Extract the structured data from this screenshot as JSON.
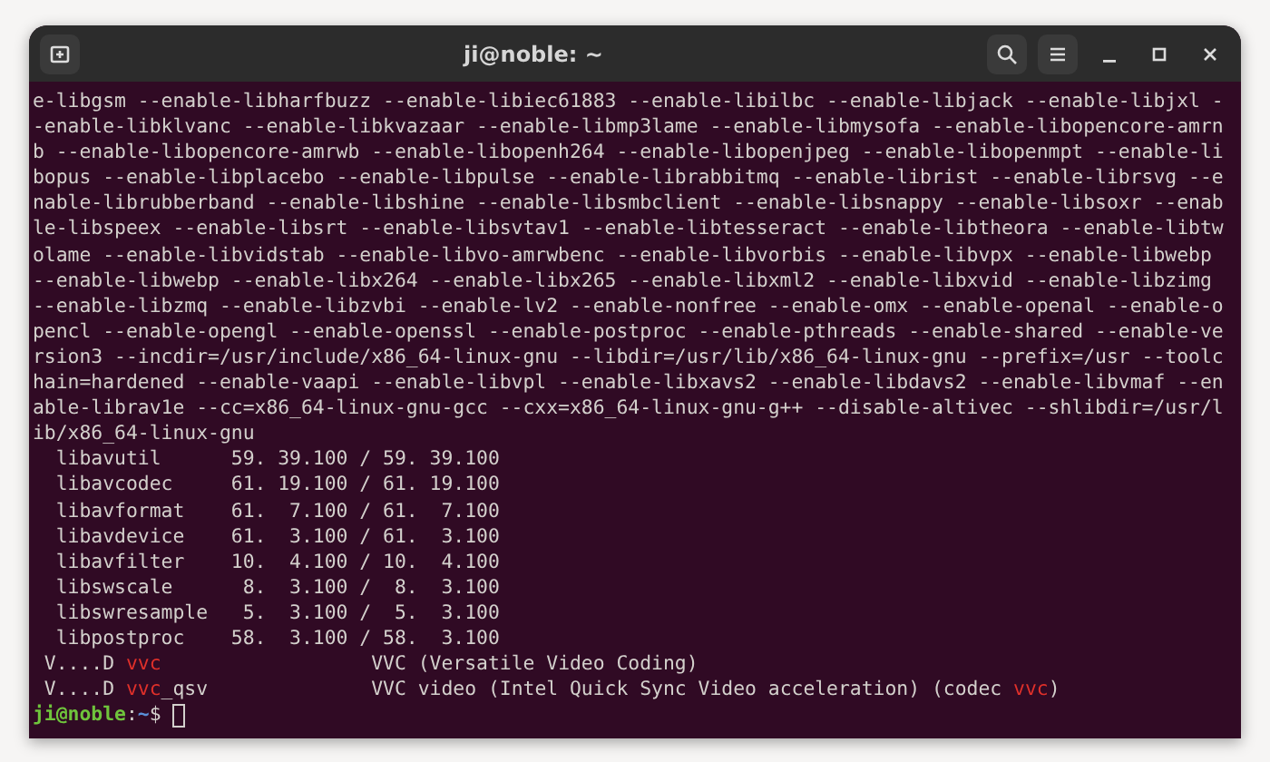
{
  "window": {
    "title": "ji@noble: ~"
  },
  "terminal": {
    "lines": [
      [
        {
          "text": "e-libgsm --enable-libharfbuzz --enable-libiec61883 --enable-libilbc --enable-libjack --enable-libjxl -",
          "kind": "plain"
        }
      ],
      [
        {
          "text": "-enable-libklvanc --enable-libkvazaar --enable-libmp3lame --enable-libmysofa --enable-libopencore-amrn",
          "kind": "plain"
        }
      ],
      [
        {
          "text": "b --enable-libopencore-amrwb --enable-libopenh264 --enable-libopenjpeg --enable-libopenmpt --enable-li",
          "kind": "plain"
        }
      ],
      [
        {
          "text": "bopus --enable-libplacebo --enable-libpulse --enable-librabbitmq --enable-librist --enable-librsvg --e",
          "kind": "plain"
        }
      ],
      [
        {
          "text": "nable-librubberband --enable-libshine --enable-libsmbclient --enable-libsnappy --enable-libsoxr --enab",
          "kind": "plain"
        }
      ],
      [
        {
          "text": "le-libspeex --enable-libsrt --enable-libsvtav1 --enable-libtesseract --enable-libtheora --enable-libtw",
          "kind": "plain"
        }
      ],
      [
        {
          "text": "olame --enable-libvidstab --enable-libvo-amrwbenc --enable-libvorbis --enable-libvpx --enable-libwebp",
          "kind": "plain"
        }
      ],
      [
        {
          "text": "--enable-libwebp --enable-libx264 --enable-libx265 --enable-libxml2 --enable-libxvid --enable-libzimg",
          "kind": "plain"
        }
      ],
      [
        {
          "text": "--enable-libzmq --enable-libzvbi --enable-lv2 --enable-nonfree --enable-omx --enable-openal --enable-o",
          "kind": "plain"
        }
      ],
      [
        {
          "text": "pencl --enable-opengl --enable-openssl --enable-postproc --enable-pthreads --enable-shared --enable-ve",
          "kind": "plain"
        }
      ],
      [
        {
          "text": "rsion3 --incdir=/usr/include/x86_64-linux-gnu --libdir=/usr/lib/x86_64-linux-gnu --prefix=/usr --toolc",
          "kind": "plain"
        }
      ],
      [
        {
          "text": "hain=hardened --enable-vaapi --enable-libvpl --enable-libxavs2 --enable-libdavs2 --enable-libvmaf --en",
          "kind": "plain"
        }
      ],
      [
        {
          "text": "able-librav1e --cc=x86_64-linux-gnu-gcc --cxx=x86_64-linux-gnu-g++ --disable-altivec --shlibdir=/usr/l",
          "kind": "plain"
        }
      ],
      [
        {
          "text": "ib/x86_64-linux-gnu",
          "kind": "plain"
        }
      ],
      [
        {
          "text": "  libavutil      59. 39.100 / 59. 39.100",
          "kind": "plain"
        }
      ],
      [
        {
          "text": "  libavcodec     61. 19.100 / 61. 19.100",
          "kind": "plain"
        }
      ],
      [
        {
          "text": "  libavformat    61.  7.100 / 61.  7.100",
          "kind": "plain"
        }
      ],
      [
        {
          "text": "  libavdevice    61.  3.100 / 61.  3.100",
          "kind": "plain"
        }
      ],
      [
        {
          "text": "  libavfilter    10.  4.100 / 10.  4.100",
          "kind": "plain"
        }
      ],
      [
        {
          "text": "  libswscale      8.  3.100 /  8.  3.100",
          "kind": "plain"
        }
      ],
      [
        {
          "text": "  libswresample   5.  3.100 /  5.  3.100",
          "kind": "plain"
        }
      ],
      [
        {
          "text": "  libpostproc    58.  3.100 / 58.  3.100",
          "kind": "plain"
        }
      ],
      [
        {
          "text": " V....D ",
          "kind": "plain"
        },
        {
          "text": "vvc",
          "kind": "highlight"
        },
        {
          "text": "                  VVC (Versatile Video Coding)",
          "kind": "plain"
        }
      ],
      [
        {
          "text": " V....D ",
          "kind": "plain"
        },
        {
          "text": "vvc",
          "kind": "highlight"
        },
        {
          "text": "_qsv              VVC video (Intel Quick Sync Video acceleration) (codec ",
          "kind": "plain"
        },
        {
          "text": "vvc",
          "kind": "highlight"
        },
        {
          "text": ")",
          "kind": "plain"
        }
      ]
    ],
    "prompt": {
      "user_host": "ji@noble",
      "separator": ":",
      "path": "~",
      "symbol": "$ "
    }
  }
}
